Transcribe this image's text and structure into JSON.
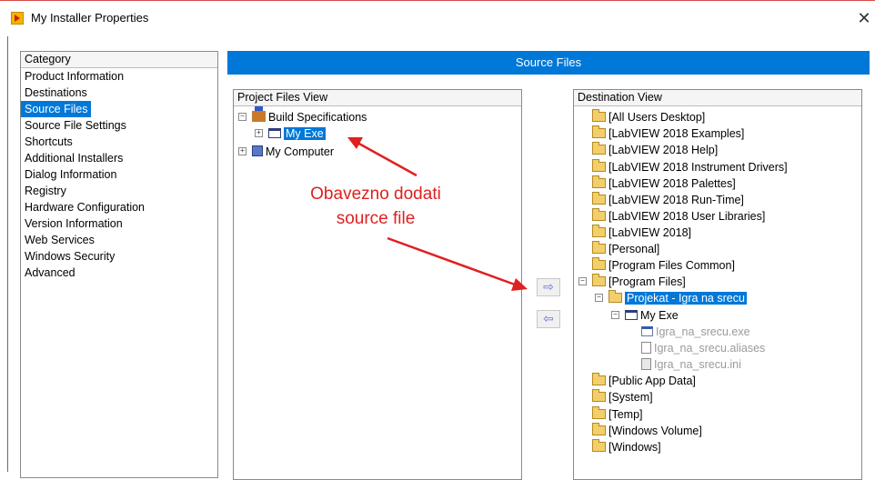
{
  "window": {
    "title": "My Installer Properties",
    "close_glyph": "✕"
  },
  "category": {
    "header": "Category",
    "items": [
      "Product Information",
      "Destinations",
      "Source Files",
      "Source File Settings",
      "Shortcuts",
      "Additional Installers",
      "Dialog Information",
      "Registry",
      "Hardware Configuration",
      "Version Information",
      "Web Services",
      "Windows Security",
      "Advanced"
    ],
    "selected": "Source Files"
  },
  "banner": {
    "title": "Source Files"
  },
  "project_view": {
    "header": "Project Files View",
    "build_specs": "Build Specifications",
    "my_exe": "My Exe",
    "my_computer": "My Computer"
  },
  "buttons": {
    "add_arrow": "⇨",
    "remove_arrow": "⇦"
  },
  "annotation": {
    "line1": "Obavezno dodati",
    "line2": "source file",
    "color": "#e02020"
  },
  "dest_view": {
    "header": "Destination View",
    "folders_top": [
      "[All Users Desktop]",
      "[LabVIEW 2018 Examples]",
      "[LabVIEW 2018 Help]",
      "[LabVIEW 2018 Instrument Drivers]",
      "[LabVIEW 2018 Palettes]",
      "[LabVIEW 2018 Run-Time]",
      "[LabVIEW 2018 User Libraries]",
      "[LabVIEW 2018]",
      "[Personal]",
      "[Program Files Common]",
      "[Program Files]"
    ],
    "project_folder": "Projekat - Igra na srecu",
    "exe_node": "My Exe",
    "files": [
      "Igra_na_srecu.exe",
      "Igra_na_srecu.aliases",
      "Igra_na_srecu.ini"
    ],
    "folders_bottom": [
      "[Public App Data]",
      "[System]",
      "[Temp]",
      "[Windows Volume]",
      "[Windows]"
    ]
  },
  "colors": {
    "accent": "#0078d7"
  }
}
